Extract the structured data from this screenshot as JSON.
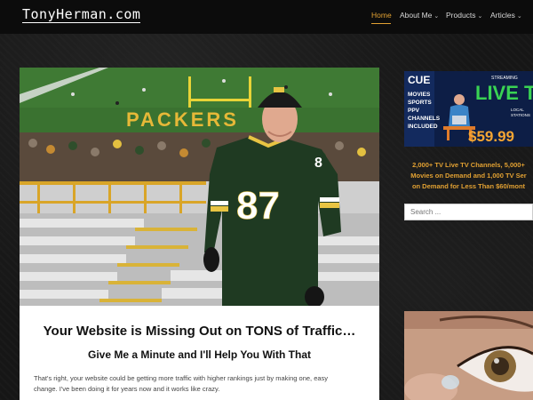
{
  "site": {
    "logo": "TonyHerman.com"
  },
  "nav": {
    "items": [
      {
        "label": "Home",
        "active": true,
        "dropdown": false
      },
      {
        "label": "About Me",
        "active": false,
        "dropdown": true
      },
      {
        "label": "Products",
        "active": false,
        "dropdown": true
      },
      {
        "label": "Articles",
        "active": false,
        "dropdown": true
      },
      {
        "label": "",
        "active": false,
        "dropdown": false
      }
    ],
    "caret": "⌄"
  },
  "hero": {
    "field_text": "PACKERS",
    "jersey_number": "87",
    "sleeve_number": "8"
  },
  "content": {
    "headline": "Your Website is Missing Out on TONS of Traffic…",
    "subheadline": "Give Me a Minute and I'll Help You With That",
    "paragraph_line1": "That's right, your website could be getting more traffic with higher rankings just by making one, easy",
    "paragraph_line2": "change. I've been doing it for years now and it works like crazy."
  },
  "sidebar": {
    "ad": {
      "brand": "CUE",
      "streaming": "STREAMING",
      "headline": "LIVE TV",
      "features": [
        "MOVIES",
        "SPORTS",
        "PPV",
        "CHANNELS",
        "INCLUDED"
      ],
      "local": "LOCAL",
      "stations": "STATIONS",
      "price": "$59.99"
    },
    "promo_lines": [
      "2,000+ TV Live TV Channels, 5,000+",
      "Movies on Demand and 1,000 TV Ser",
      "on Demand for Less Than $60/mont"
    ],
    "search": {
      "placeholder": "Search ..."
    }
  },
  "colors": {
    "accent": "#e2a132",
    "ad_green": "#39d353",
    "jersey_green": "#1f3a22"
  }
}
